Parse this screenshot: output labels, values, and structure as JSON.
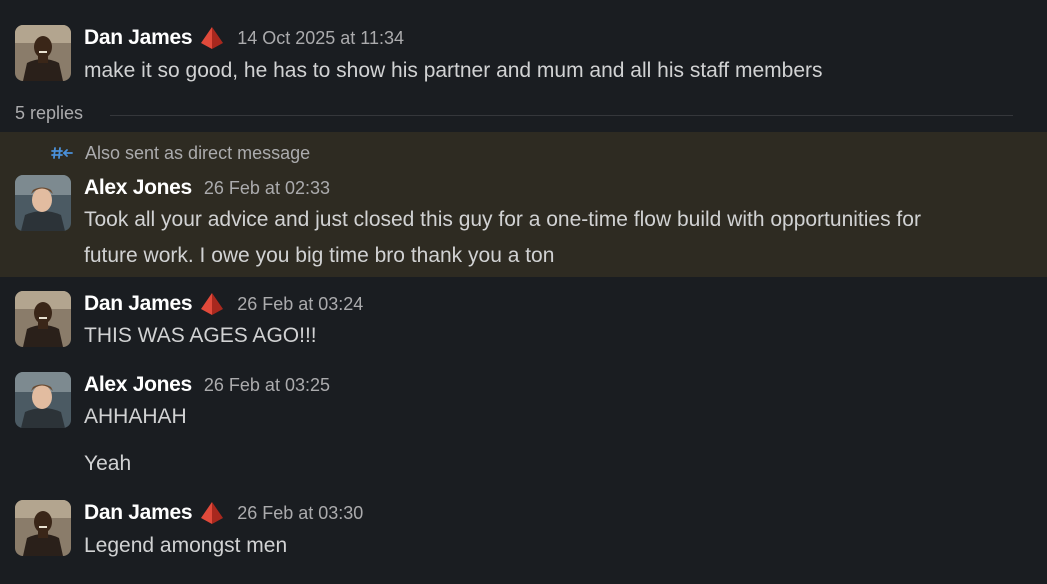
{
  "thread": {
    "parent": {
      "author": "Dan James",
      "timestamp": "14 Oct 2025 at 11:34",
      "text": "make it so good, he has to show his partner and mum and all his staff members",
      "badge_icon": "red-pyramid-icon"
    },
    "replies_label": "5 replies",
    "also_sent_label": "Also sent as direct message",
    "also_sent_icon": "hash-arrow-icon",
    "messages": [
      {
        "author": "Alex Jones",
        "timestamp": "26 Feb at 02:33",
        "lines": [
          "Took all your advice and just closed this guy for a one-time flow build with opportunities for",
          "future work. I owe you big time bro thank you a ton"
        ]
      },
      {
        "author": "Dan James",
        "timestamp": "26 Feb at 03:24",
        "text": "THIS WAS AGES AGO!!!",
        "badge_icon": "red-pyramid-icon"
      },
      {
        "author": "Alex Jones",
        "timestamp": "26 Feb at 03:25",
        "text": "AHHAHAH",
        "followup": "Yeah"
      },
      {
        "author": "Dan James",
        "timestamp": "26 Feb at 03:30",
        "text": "Legend amongst men",
        "badge_icon": "red-pyramid-icon"
      }
    ]
  },
  "colors": {
    "background": "#1a1d21",
    "highlight": "#2e2b22",
    "name": "#ffffff",
    "text": "#d1d2d3",
    "muted": "#ababad",
    "badge": "#c0392b",
    "dm_icon": "#4a90d9"
  }
}
